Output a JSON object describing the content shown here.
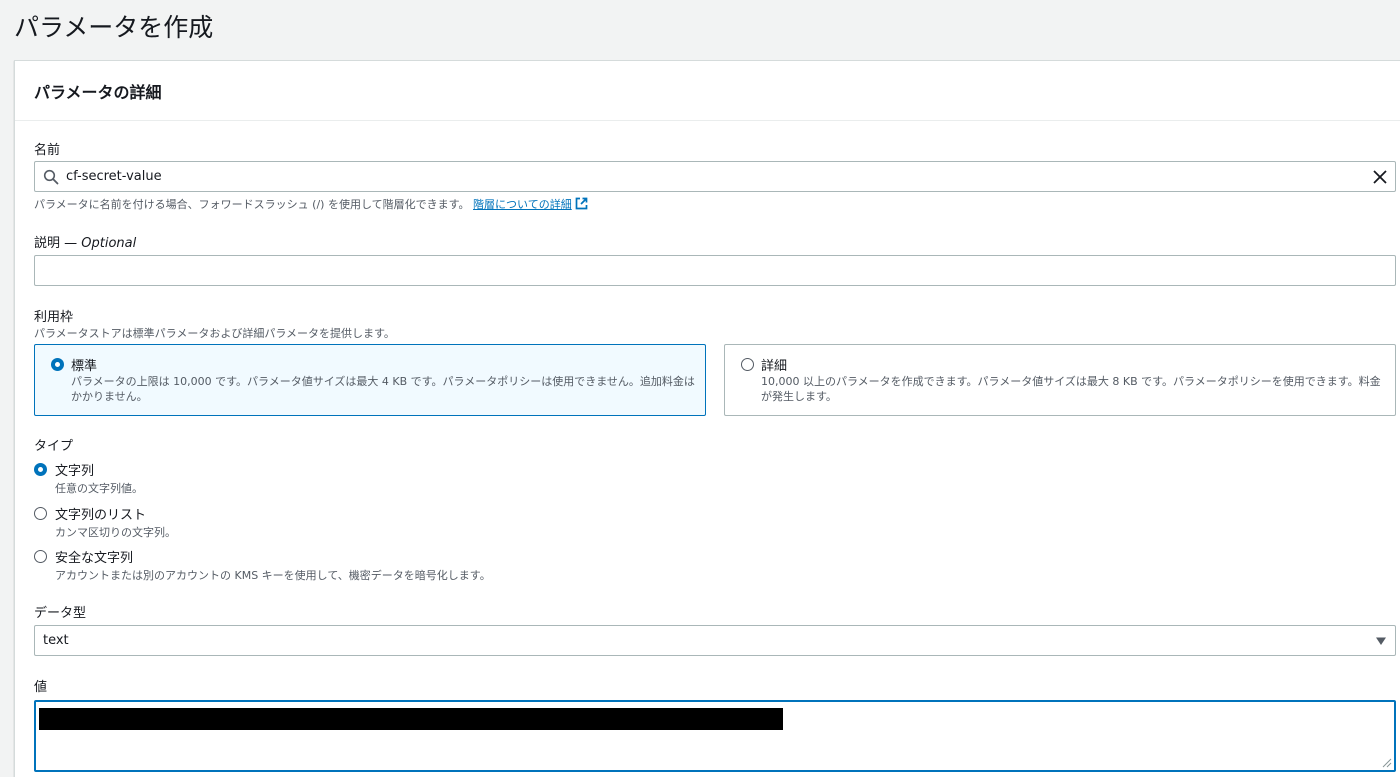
{
  "page": {
    "title": "パラメータを作成"
  },
  "panel": {
    "title": "パラメータの詳細"
  },
  "name": {
    "label": "名前",
    "value": "cf-secret-value",
    "hint": "パラメータに名前を付ける場合、フォワードスラッシュ (/) を使用して階層化できます。",
    "hint_link": "階層についての詳細"
  },
  "description": {
    "label": "説明",
    "optional": " — Optional",
    "value": ""
  },
  "tier": {
    "label": "利用枠",
    "hint": "パラメータストアは標準パラメータおよび詳細パラメータを提供します。",
    "options": [
      {
        "label": "標準",
        "desc": "パラメータの上限は 10,000 です。パラメータ値サイズは最大 4 KB です。パラメータポリシーは使用できません。追加料金はかかりません。",
        "selected": true
      },
      {
        "label": "詳細",
        "desc": "10,000 以上のパラメータを作成できます。パラメータ値サイズは最大 8 KB です。パラメータポリシーを使用できます。料金が発生します。",
        "selected": false
      }
    ]
  },
  "type": {
    "label": "タイプ",
    "options": [
      {
        "label": "文字列",
        "desc": "任意の文字列値。",
        "selected": true
      },
      {
        "label": "文字列のリスト",
        "desc": "カンマ区切りの文字列。",
        "selected": false
      },
      {
        "label": "安全な文字列",
        "desc": "アカウントまたは別のアカウントの KMS キーを使用して、機密データを暗号化します。",
        "selected": false
      }
    ]
  },
  "data_type": {
    "label": "データ型",
    "value": "text"
  },
  "value": {
    "label": "値"
  },
  "colors": {
    "accent": "#0073bb",
    "border": "#aab7b8",
    "background": "#f2f3f3"
  },
  "icons": {
    "search": "search-icon",
    "clear": "close-icon",
    "external": "external-link-icon",
    "dropdown": "caret-down-icon"
  }
}
